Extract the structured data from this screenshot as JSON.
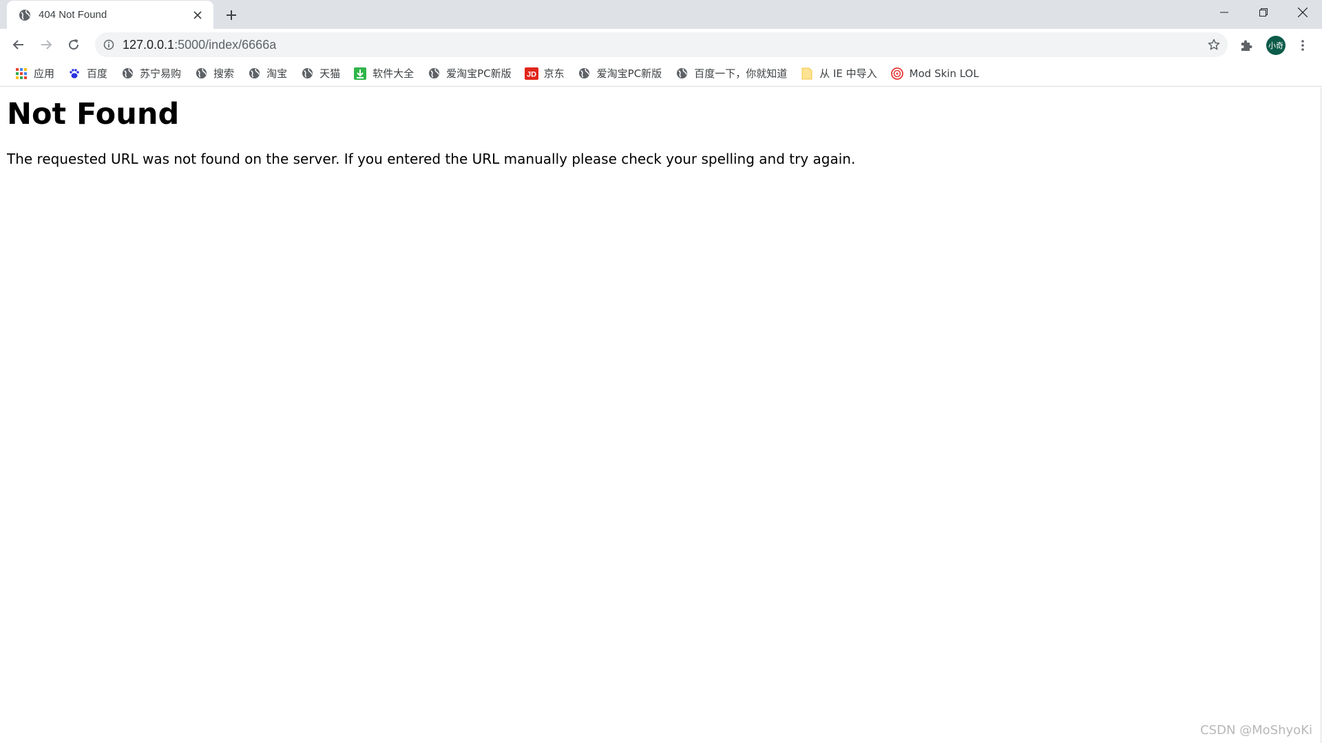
{
  "tab": {
    "title": "404 Not Found",
    "favicon": "globe-icon"
  },
  "window_controls": [
    "minimize-icon",
    "restore-icon",
    "close-icon"
  ],
  "omnibox": {
    "url_host": "127.0.0.1",
    "url_rest": ":5000/index/6666a"
  },
  "profile": {
    "avatar_text": "小奇",
    "avatar_color": "#0d5c4a"
  },
  "bookmarks": [
    {
      "label": "应用",
      "icon": "apps-grid-icon"
    },
    {
      "label": "百度",
      "icon": "baidu-paw-icon"
    },
    {
      "label": "苏宁易购",
      "icon": "globe-icon"
    },
    {
      "label": "搜索",
      "icon": "globe-icon"
    },
    {
      "label": "淘宝",
      "icon": "globe-icon"
    },
    {
      "label": "天猫",
      "icon": "globe-icon"
    },
    {
      "label": "软件大全",
      "icon": "download-icon"
    },
    {
      "label": "爱淘宝PC新版",
      "icon": "globe-icon"
    },
    {
      "label": "京东",
      "icon": "jd-icon"
    },
    {
      "label": "爱淘宝PC新版",
      "icon": "globe-icon"
    },
    {
      "label": "百度一下，你就知道",
      "icon": "globe-icon"
    },
    {
      "label": "从 IE 中导入",
      "icon": "folder-icon"
    },
    {
      "label": "Mod Skin LOL",
      "icon": "modskin-icon"
    }
  ],
  "page": {
    "heading": "Not Found",
    "message": "The requested URL was not found on the server. If you entered the URL manually please check your spelling and try again."
  },
  "watermark": "CSDN @MoShyoKi",
  "colors": {
    "tabstrip": "#dee1e6",
    "omnibox": "#f1f3f4",
    "icon_gray": "#5f6368"
  }
}
